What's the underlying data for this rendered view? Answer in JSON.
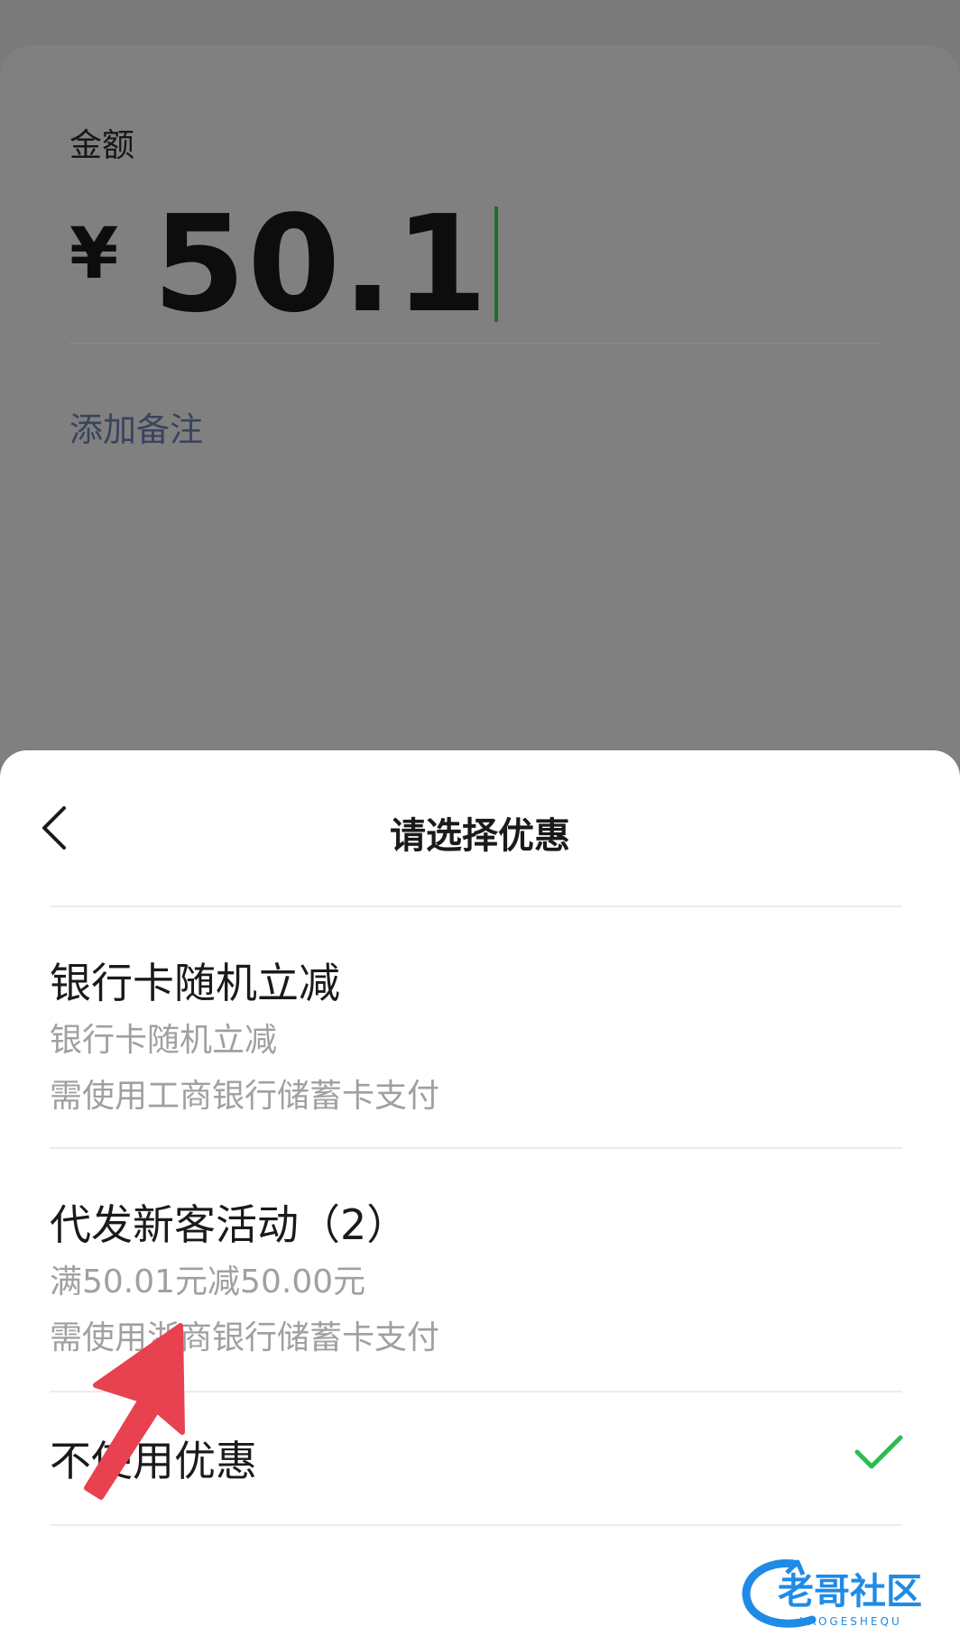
{
  "amount_section": {
    "label": "金额",
    "currency_symbol": "¥",
    "amount_value": "50.1",
    "add_note": "添加备注"
  },
  "sheet": {
    "title": "请选择优惠",
    "back_icon": "chevron-left-icon"
  },
  "options": [
    {
      "title": "银行卡随机立减",
      "line1": "银行卡随机立减",
      "line2": "需使用工商银行储蓄卡支付"
    },
    {
      "title": "代发新客活动（2）",
      "line1": "满50.01元减50.00元",
      "line2": "需使用浙商银行储蓄卡支付"
    },
    {
      "title": "不使用优惠",
      "selected": true
    }
  ],
  "watermark": {
    "text": "老哥社区",
    "subtext": "LAOGESHEQU"
  },
  "colors": {
    "accent_green": "#2dbd4e",
    "arrow_red": "#e8414f",
    "watermark_blue": "#1f8be6"
  }
}
